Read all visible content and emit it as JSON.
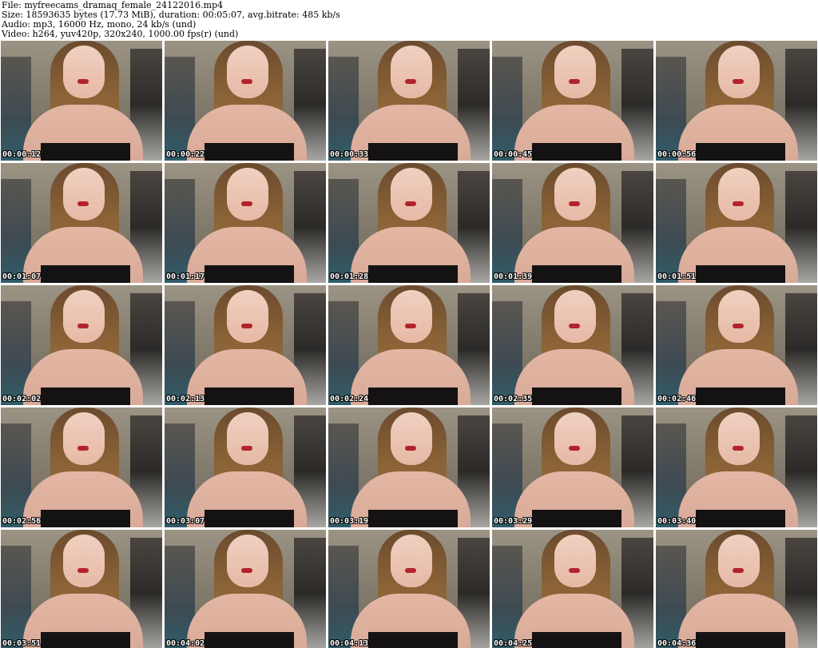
{
  "header": {
    "file_line": "File: myfreecams_dramaq_female_24122016.mp4",
    "size_line": "Size: 18593635 bytes (17.73 MiB), duration: 00:05:07, avg.bitrate: 485 kb/s",
    "audio_line": "Audio: mp3, 16000 Hz, mono, 24 kb/s (und)",
    "video_line": "Video: h264, yuv420p, 320x240, 1000.00 fps(r) (und)"
  },
  "thumbnails": [
    {
      "timestamp": "00:00:12"
    },
    {
      "timestamp": "00:00:22"
    },
    {
      "timestamp": "00:00:33"
    },
    {
      "timestamp": "00:00:45"
    },
    {
      "timestamp": "00:00:56"
    },
    {
      "timestamp": "00:01:07"
    },
    {
      "timestamp": "00:01:17"
    },
    {
      "timestamp": "00:01:28"
    },
    {
      "timestamp": "00:01:39"
    },
    {
      "timestamp": "00:01:51"
    },
    {
      "timestamp": "00:02:02"
    },
    {
      "timestamp": "00:02:13"
    },
    {
      "timestamp": "00:02:24"
    },
    {
      "timestamp": "00:02:35"
    },
    {
      "timestamp": "00:02:46"
    },
    {
      "timestamp": "00:02:56"
    },
    {
      "timestamp": "00:03:07"
    },
    {
      "timestamp": "00:03:19"
    },
    {
      "timestamp": "00:03:29"
    },
    {
      "timestamp": "00:03:40"
    },
    {
      "timestamp": "00:03:51"
    },
    {
      "timestamp": "00:04:02"
    },
    {
      "timestamp": "00:04:13"
    },
    {
      "timestamp": "00:04:25"
    },
    {
      "timestamp": "00:04:36"
    }
  ]
}
